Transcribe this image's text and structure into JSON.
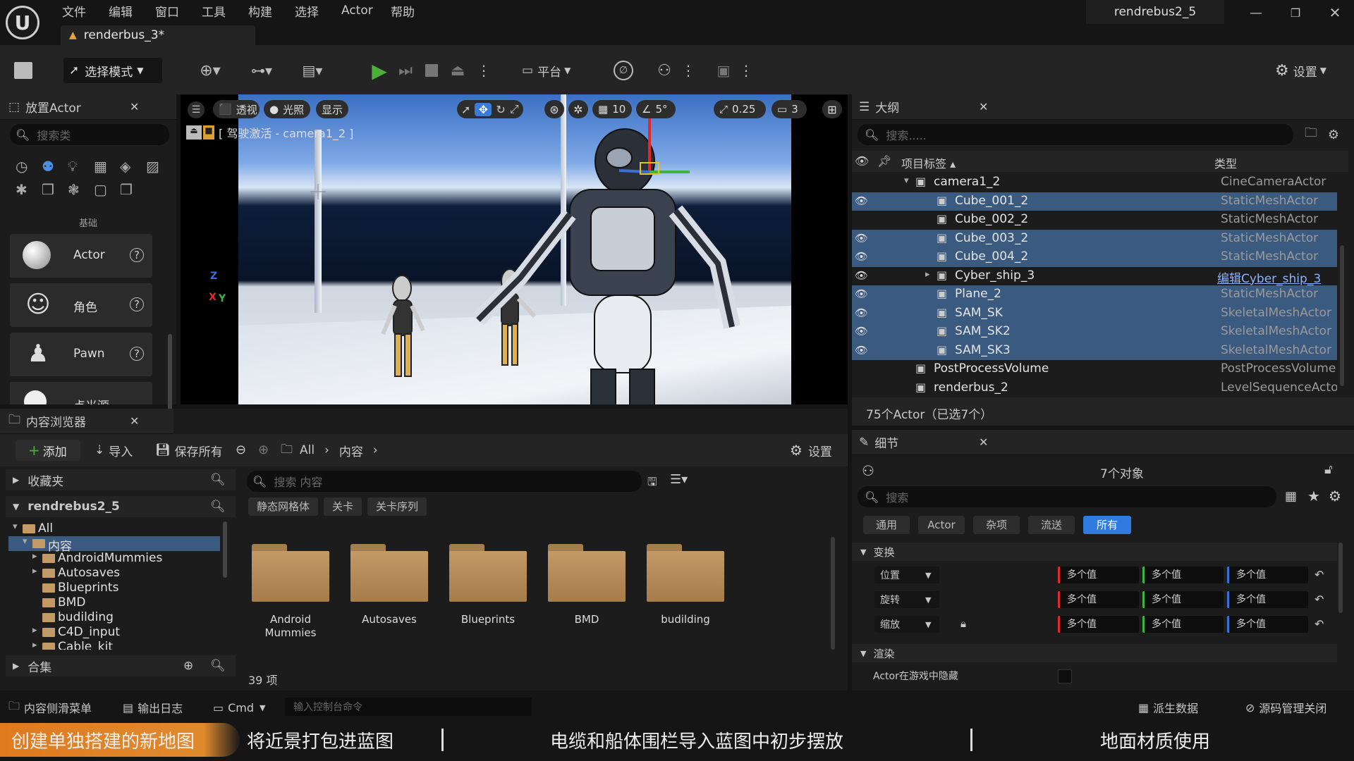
{
  "menu": [
    "文件",
    "编辑",
    "窗口",
    "工具",
    "构建",
    "选择",
    "Actor",
    "帮助"
  ],
  "project_name": "rendrebus2_5",
  "level_tab": "renderbus_3*",
  "toolbar": {
    "mode": "选择模式",
    "platform": "平台",
    "settings": "设置"
  },
  "place_actor": {
    "title": "放置Actor",
    "search_placeholder": "搜索类",
    "category": "基础",
    "items": [
      "Actor",
      "角色",
      "Pawn",
      "点光源"
    ]
  },
  "viewport": {
    "perspective": "透视",
    "lit": "光照",
    "show": "显示",
    "pilot_label": "[ 驾驶激活 - camera1_2 ]",
    "grid_snap": "10",
    "rot_snap": "5°",
    "scale_snap": "0.25",
    "cam_speed": "3"
  },
  "outliner": {
    "title": "大纲",
    "search_placeholder": "搜索.....",
    "col_label": "项目标签 ▴",
    "col_type": "类型",
    "rows": [
      {
        "name": "camera1_2",
        "type": "CineCameraActor",
        "indent": 1,
        "selected": false,
        "eye": false,
        "expander": "▾",
        "link": false
      },
      {
        "name": "Cube_001_2",
        "type": "StaticMeshActor",
        "indent": 2,
        "selected": true,
        "eye": true,
        "expander": "",
        "link": false
      },
      {
        "name": "Cube_002_2",
        "type": "StaticMeshActor",
        "indent": 2,
        "selected": false,
        "eye": false,
        "expander": "",
        "link": false
      },
      {
        "name": "Cube_003_2",
        "type": "StaticMeshActor",
        "indent": 2,
        "selected": true,
        "eye": true,
        "expander": "",
        "link": false
      },
      {
        "name": "Cube_004_2",
        "type": "StaticMeshActor",
        "indent": 2,
        "selected": true,
        "eye": true,
        "expander": "",
        "link": false
      },
      {
        "name": "Cyber_ship_3",
        "type": "编辑Cyber_ship_3",
        "indent": 2,
        "selected": false,
        "eye": true,
        "expander": "▸",
        "link": true
      },
      {
        "name": "Plane_2",
        "type": "StaticMeshActor",
        "indent": 2,
        "selected": true,
        "eye": true,
        "expander": "",
        "link": false
      },
      {
        "name": "SAM_SK",
        "type": "SkeletalMeshActor",
        "indent": 2,
        "selected": true,
        "eye": true,
        "expander": "",
        "link": false
      },
      {
        "name": "SAM_SK2",
        "type": "SkeletalMeshActor",
        "indent": 2,
        "selected": true,
        "eye": true,
        "expander": "",
        "link": false
      },
      {
        "name": "SAM_SK3",
        "type": "SkeletalMeshActor",
        "indent": 2,
        "selected": true,
        "eye": true,
        "expander": "",
        "link": false
      },
      {
        "name": "PostProcessVolume",
        "type": "PostProcessVolume",
        "indent": 1,
        "selected": false,
        "eye": false,
        "expander": "",
        "link": false
      },
      {
        "name": "renderbus_2",
        "type": "LevelSequenceActor",
        "indent": 1,
        "selected": false,
        "eye": false,
        "expander": "",
        "link": false
      }
    ],
    "footer": "75个Actor（已选7个）"
  },
  "content_browser": {
    "title": "内容浏览器",
    "add": "添加",
    "import": "导入",
    "save_all": "保存所有",
    "path": [
      "All",
      "内容"
    ],
    "settings": "设置",
    "favorites": "收藏夹",
    "project": "rendrebus2_5",
    "tree": [
      {
        "label": "All",
        "indent": 0,
        "expander": "▾",
        "selected": false
      },
      {
        "label": "内容",
        "indent": 1,
        "expander": "▾",
        "selected": true
      },
      {
        "label": "AndroidMummies",
        "indent": 2,
        "expander": "▸",
        "selected": false
      },
      {
        "label": "Autosaves",
        "indent": 2,
        "expander": "▸",
        "selected": false
      },
      {
        "label": "Blueprints",
        "indent": 2,
        "expander": "",
        "selected": false
      },
      {
        "label": "BMD",
        "indent": 2,
        "expander": "",
        "selected": false
      },
      {
        "label": "budilding",
        "indent": 2,
        "expander": "",
        "selected": false
      },
      {
        "label": "C4D_input",
        "indent": 2,
        "expander": "▸",
        "selected": false
      },
      {
        "label": "Cable_kit",
        "indent": 2,
        "expander": "▸",
        "selected": false
      }
    ],
    "collections": "合集",
    "search_placeholder": "搜索 内容",
    "filters": [
      "静态网格体",
      "关卡",
      "关卡序列"
    ],
    "folders": [
      "Android Mummies",
      "Autosaves",
      "Blueprints",
      "BMD",
      "budilding"
    ],
    "item_count": "39 项"
  },
  "details": {
    "title": "细节",
    "object_count": "7个对象",
    "search_placeholder": "搜索",
    "tabs": [
      "通用",
      "Actor",
      "杂项",
      "流送",
      "所有"
    ],
    "transform_section": "变换",
    "props": [
      {
        "label": "位置",
        "values": [
          "多个值",
          "多个值",
          "多个值"
        ]
      },
      {
        "label": "旋转",
        "values": [
          "多个值",
          "多个值",
          "多个值"
        ]
      },
      {
        "label": "缩放",
        "values": [
          "多个值",
          "多个值",
          "多个值"
        ]
      }
    ],
    "render_section": "渲染",
    "hidden_in_game": "Actor在游戏中隐藏"
  },
  "statusbar": {
    "drawer": "内容侧滑菜单",
    "output_log": "输出日志",
    "cmd": "Cmd",
    "console_placeholder": "输入控制台命令",
    "derived_data": "派生数据",
    "source_control": "源码管理关闭"
  },
  "chapters": [
    "创建单独搭建的新地图",
    "将近景打包进蓝图",
    "电缆和船体围栏导入蓝图中初步摆放",
    "地面材质使用"
  ],
  "colors": {
    "accent": "#3a7bd5",
    "play": "#4caf3a",
    "selection": "#3b5a7f",
    "chapter_active": "#e07a1e"
  }
}
